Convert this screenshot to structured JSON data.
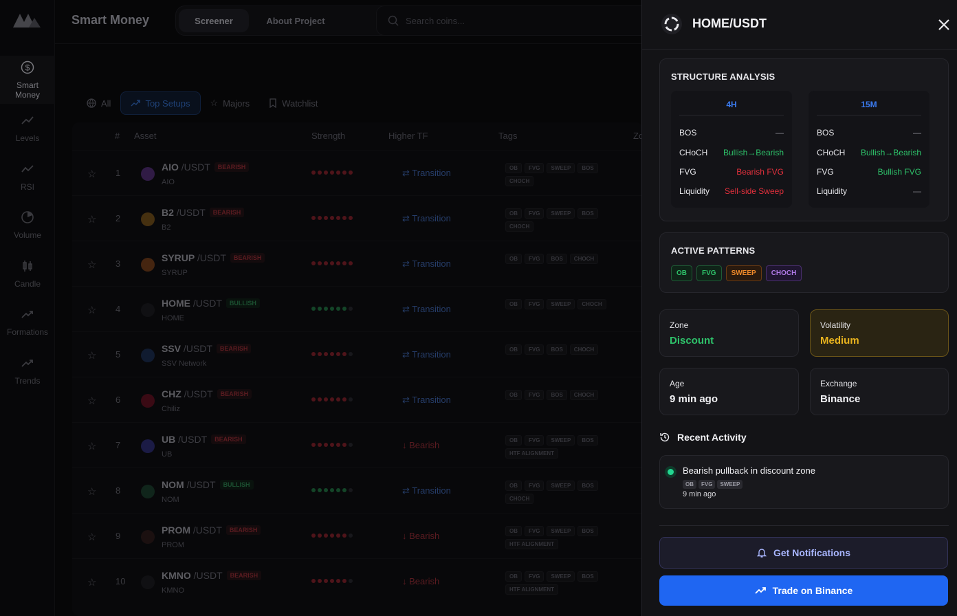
{
  "brand": "Smart Money",
  "header": {
    "tab_screener": "Screener",
    "tab_about": "About Project",
    "search_placeholder": "Search coins..."
  },
  "rail": [
    {
      "label": "Smart Money",
      "icon": "dollar-icon"
    },
    {
      "label": "Levels",
      "icon": "levels-icon"
    },
    {
      "label": "RSI",
      "icon": "rsi-icon"
    },
    {
      "label": "Volume",
      "icon": "volume-icon"
    },
    {
      "label": "Candle",
      "icon": "candle-icon"
    },
    {
      "label": "Formations",
      "icon": "formations-icon"
    },
    {
      "label": "Trends",
      "icon": "trends-icon"
    }
  ],
  "filters": {
    "all": "All",
    "top": "Top Setups",
    "majors": "Majors",
    "watchlist": "Watchlist"
  },
  "table": {
    "columns": {
      "num": "#",
      "asset": "Asset",
      "strength": "Strength",
      "htf": "Higher TF",
      "tags": "Tags",
      "zone": "Zo"
    },
    "rows": [
      {
        "num": "1",
        "sym": "AIO",
        "quote": "/USDT",
        "badge": "BEARISH",
        "bull": false,
        "name": "AIO",
        "strength": 7,
        "htf": "Transition",
        "tags": [
          "OB",
          "FVG",
          "SWEEP",
          "BOS",
          "CHOCH"
        ],
        "color": "#4a2a6a"
      },
      {
        "num": "2",
        "sym": "B2",
        "quote": "/USDT",
        "badge": "BEARISH",
        "bull": false,
        "name": "B2",
        "strength": 7,
        "htf": "Transition",
        "tags": [
          "OB",
          "FVG",
          "SWEEP",
          "BOS",
          "CHOCH"
        ],
        "color": "#6a4a1a"
      },
      {
        "num": "3",
        "sym": "SYRUP",
        "quote": "/USDT",
        "badge": "BEARISH",
        "bull": false,
        "name": "SYRUP",
        "strength": 7,
        "htf": "Transition",
        "tags": [
          "OB",
          "FVG",
          "BOS",
          "CHOCH"
        ],
        "color": "#6a3a1a"
      },
      {
        "num": "4",
        "sym": "HOME",
        "quote": "/USDT",
        "badge": "BULLISH",
        "bull": true,
        "name": "HOME",
        "strength": 6,
        "htf": "Transition",
        "tags": [
          "OB",
          "FVG",
          "SWEEP",
          "CHOCH"
        ],
        "color": "#1a1a1e"
      },
      {
        "num": "5",
        "sym": "SSV",
        "quote": "/USDT",
        "badge": "BEARISH",
        "bull": false,
        "name": "SSV Network",
        "strength": 6,
        "htf": "Transition",
        "tags": [
          "OB",
          "FVG",
          "BOS",
          "CHOCH"
        ],
        "color": "#1a2a4a"
      },
      {
        "num": "6",
        "sym": "CHZ",
        "quote": "/USDT",
        "badge": "BEARISH",
        "bull": false,
        "name": "Chiliz",
        "strength": 6,
        "htf": "Transition",
        "tags": [
          "OB",
          "FVG",
          "BOS",
          "CHOCH"
        ],
        "color": "#5a1020"
      },
      {
        "num": "7",
        "sym": "UB",
        "quote": "/USDT",
        "badge": "BEARISH",
        "bull": false,
        "name": "UB",
        "strength": 6,
        "htf": "Bearish",
        "tags": [
          "OB",
          "FVG",
          "SWEEP",
          "BOS",
          "HTF ALIGNMENT"
        ],
        "color": "#2a2a6a"
      },
      {
        "num": "8",
        "sym": "NOM",
        "quote": "/USDT",
        "badge": "BULLISH",
        "bull": true,
        "name": "NOM",
        "strength": 6,
        "htf": "Transition",
        "tags": [
          "OB",
          "FVG",
          "SWEEP",
          "BOS",
          "CHOCH"
        ],
        "color": "#1a3a2a"
      },
      {
        "num": "9",
        "sym": "PROM",
        "quote": "/USDT",
        "badge": "BEARISH",
        "bull": false,
        "name": "PROM",
        "strength": 6,
        "htf": "Bearish",
        "tags": [
          "OB",
          "FVG",
          "SWEEP",
          "BOS",
          "HTF ALIGNMENT"
        ],
        "color": "#2a1a1a"
      },
      {
        "num": "10",
        "sym": "KMNO",
        "quote": "/USDT",
        "badge": "BEARISH",
        "bull": false,
        "name": "KMNO",
        "strength": 6,
        "htf": "Bearish",
        "tags": [
          "OB",
          "FVG",
          "SWEEP",
          "BOS",
          "HTF ALIGNMENT"
        ],
        "color": "#1a1a1e"
      }
    ]
  },
  "drawer": {
    "title": "HOME/USDT",
    "structure": {
      "title": "STRUCTURE ANALYSIS",
      "tf4h": {
        "label": "4H",
        "bos": "—",
        "choch": "Bullish→Bearish",
        "fvg": "Bearish FVG",
        "liq": "Sell-side Sweep"
      },
      "tf15m": {
        "label": "15M",
        "bos": "—",
        "choch": "Bullish→Bearish",
        "fvg": "Bullish FVG",
        "liq": "—"
      },
      "k_bos": "BOS",
      "k_choch": "CHoCH",
      "k_fvg": "FVG",
      "k_liq": "Liquidity"
    },
    "patterns": {
      "title": "ACTIVE PATTERNS",
      "items": [
        "OB",
        "FVG",
        "SWEEP",
        "CHOCH"
      ]
    },
    "zone": {
      "label": "Zone",
      "value": "Discount"
    },
    "volatility": {
      "label": "Volatility",
      "value": "Medium"
    },
    "age": {
      "label": "Age",
      "value": "9 min ago"
    },
    "exchange": {
      "label": "Exchange",
      "value": "Binance"
    },
    "activity": {
      "title": "Recent Activity",
      "text": "Bearish pullback in discount zone",
      "tags": [
        "OB",
        "FVG",
        "SWEEP"
      ],
      "time": "9 min ago"
    },
    "notify": "Get Notifications",
    "trade": "Trade on Binance"
  },
  "colors": {
    "accent": "#1f66f2",
    "bull": "#2ec26a",
    "bear": "#e2303c",
    "warn": "#e8b31e"
  }
}
